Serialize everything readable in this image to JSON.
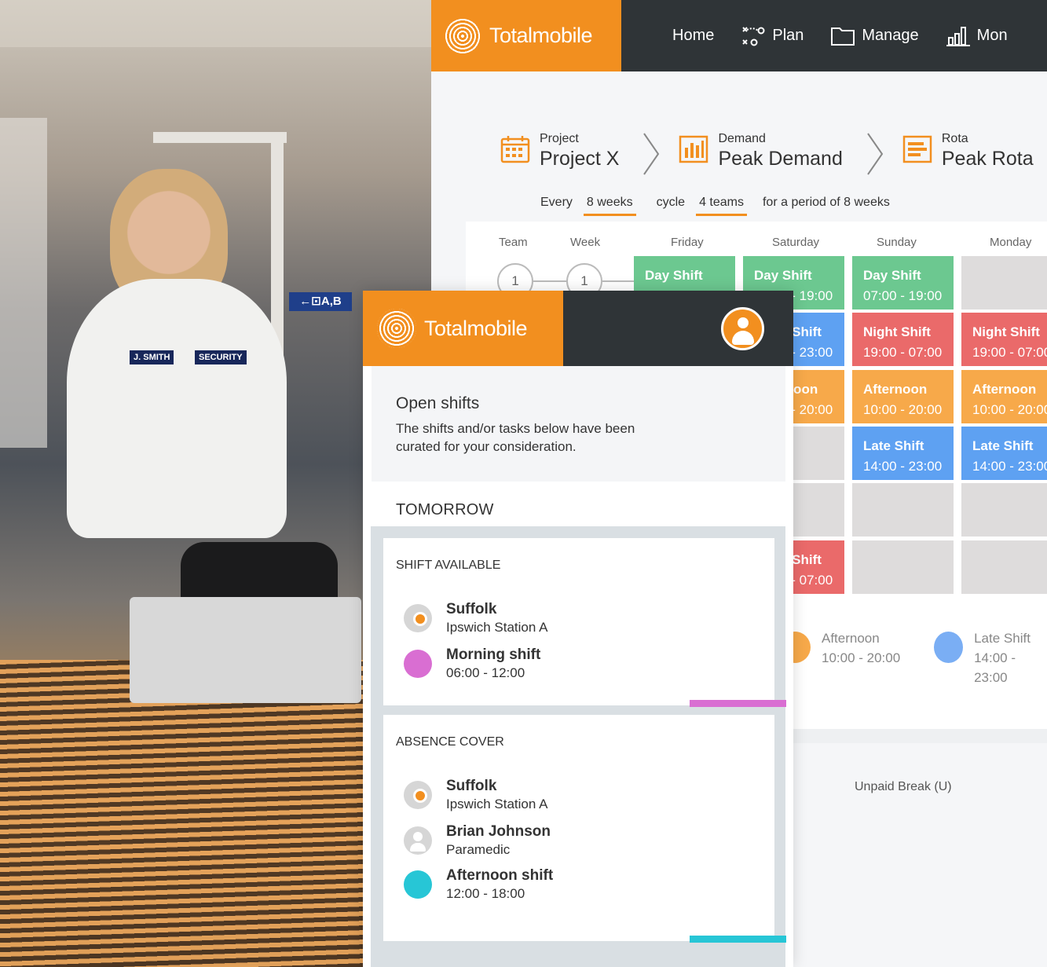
{
  "photo": {
    "sign_text": "←⊡A,B",
    "badge_left": "J. SMITH",
    "badge_right": "SECURITY"
  },
  "desktop": {
    "brand": "Totalmobile",
    "nav": [
      "Home",
      "Plan",
      "Manage",
      "Mon"
    ],
    "breadcrumbs": [
      {
        "small": "Project",
        "big": "Project X",
        "icon": "calendar-icon"
      },
      {
        "small": "Demand",
        "big": "Peak Demand",
        "icon": "bar-chart-icon"
      },
      {
        "small": "Rota",
        "big": "Peak Rota",
        "icon": "list-icon"
      }
    ],
    "cycle": {
      "every": "Every",
      "weeks": "8 weeks",
      "cycle": "cycle",
      "teams": "4 teams",
      "period": "for a period of 8 weeks"
    },
    "columns": [
      "Team",
      "Week",
      "Friday",
      "Saturday",
      "Sunday",
      "Monday"
    ],
    "team_num": "1",
    "week_num": "1",
    "rows": [
      [
        {
          "title": "Day Shift",
          "time": "07:00 - 19:00",
          "color": "green"
        },
        {
          "title": "Day Shift",
          "time": "07:00 - 19:00",
          "color": "green"
        },
        {
          "title": "Day Shift",
          "time": "07:00 - 19:00",
          "color": "green"
        },
        {
          "title": "",
          "time": "",
          "color": "gray"
        }
      ],
      [
        {
          "title": "",
          "time": "",
          "color": "gray"
        },
        {
          "title": "Night Shift",
          "time": "19:00 - 23:00",
          "color": "blue"
        },
        {
          "title": "Night Shift",
          "time": "19:00 - 07:00",
          "color": "red"
        },
        {
          "title": "Night Shift",
          "time": "19:00 - 07:00",
          "color": "red"
        }
      ],
      [
        {
          "title": "",
          "time": "",
          "color": "gray"
        },
        {
          "title": "Afternoon",
          "time": "10:00 - 20:00",
          "color": "orange"
        },
        {
          "title": "Afternoon",
          "time": "10:00 - 20:00",
          "color": "orange"
        },
        {
          "title": "Afternoon",
          "time": "10:00 - 20:00",
          "color": "orange"
        }
      ],
      [
        {
          "title": "",
          "time": "",
          "color": "gray"
        },
        {
          "title": "",
          "time": "",
          "color": "gray"
        },
        {
          "title": "Late Shift",
          "time": "14:00 - 23:00",
          "color": "blue"
        },
        {
          "title": "Late Shift",
          "time": "14:00 - 23:00",
          "color": "blue"
        }
      ],
      [
        {
          "title": "",
          "time": "",
          "color": "gray"
        },
        {
          "title": "",
          "time": "",
          "color": "gray"
        },
        {
          "title": "",
          "time": "",
          "color": "gray"
        },
        {
          "title": "",
          "time": "",
          "color": "gray"
        }
      ],
      [
        {
          "title": "",
          "time": "",
          "color": "gray"
        },
        {
          "title": "Night Shift",
          "time": "19:00 - 07:00",
          "color": "red"
        },
        {
          "title": "",
          "time": "",
          "color": "gray"
        },
        {
          "title": "",
          "time": "",
          "color": "gray"
        }
      ]
    ],
    "legend": [
      {
        "title": "Afternoon",
        "time": "10:00 - 20:00",
        "color": "#f7a94a"
      },
      {
        "title": "Late Shift",
        "time": "14:00 - 23:00",
        "color": "#7aaef4"
      }
    ],
    "unpaid_break": "Unpaid Break (U)"
  },
  "mobile": {
    "brand": "Totalmobile",
    "intro_title": "Open shifts",
    "intro_text": "The shifts and/or tasks below have been curated for your consideration.",
    "section": "TOMORROW",
    "cards": [
      {
        "heading": "SHIFT AVAILABLE",
        "strip_color": "#d96ed2",
        "rows": [
          {
            "icon": "location-pin-icon",
            "title": "Suffolk",
            "sub": "Ipswich Station A",
            "dot": ""
          },
          {
            "icon": "shift-dot-icon",
            "title": "Morning shift",
            "sub": "06:00 - 12:00",
            "dot": "#d96ed2"
          }
        ]
      },
      {
        "heading": "ABSENCE COVER",
        "strip_color": "#27c6d6",
        "rows": [
          {
            "icon": "location-pin-icon",
            "title": "Suffolk",
            "sub": "Ipswich Station A",
            "dot": ""
          },
          {
            "icon": "person-icon",
            "title": "Brian Johnson",
            "sub": "Paramedic",
            "dot": ""
          },
          {
            "icon": "shift-dot-icon",
            "title": "Afternoon shift",
            "sub": "12:00 - 18:00",
            "dot": "#27c6d6"
          }
        ]
      }
    ]
  },
  "colors": {
    "brand_orange": "#f28f1f",
    "header_dark": "#2f3437"
  }
}
